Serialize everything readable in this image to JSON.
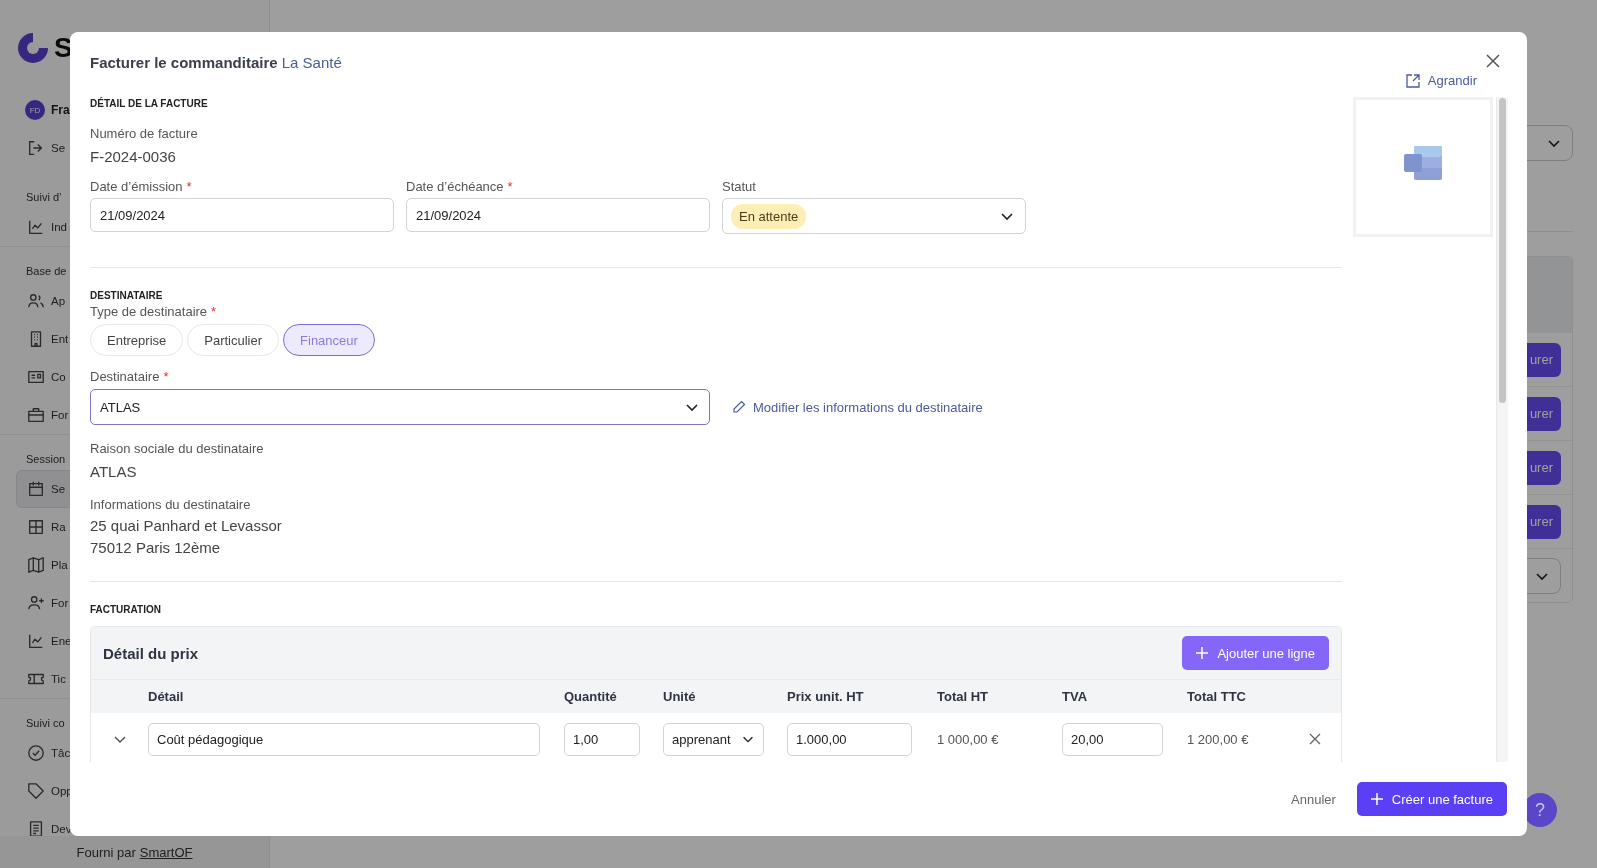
{
  "background": {
    "sidebar": {
      "logo_text": "S",
      "user": {
        "initials": "FD",
        "name": "Fra"
      },
      "top_items": [
        {
          "label": "Se",
          "selected": false
        }
      ],
      "groups": [
        {
          "heading": "Suivi d’",
          "items": [
            {
              "label": "Ind",
              "selected": false
            }
          ]
        },
        {
          "heading": "Base de",
          "items": [
            {
              "label": "Ap",
              "selected": false
            },
            {
              "label": "Ent",
              "selected": false
            },
            {
              "label": "Co",
              "selected": false
            },
            {
              "label": "For",
              "selected": false
            }
          ]
        },
        {
          "heading": "Session",
          "items": [
            {
              "label": "Se",
              "selected": true
            },
            {
              "label": "Ra",
              "selected": false
            },
            {
              "label": "Pla",
              "selected": false
            },
            {
              "label": "For",
              "selected": false
            },
            {
              "label": "Ene",
              "selected": false
            },
            {
              "label": "Tic",
              "selected": false
            }
          ]
        },
        {
          "heading": "Suivi co",
          "items": [
            {
              "label": "Tâc",
              "selected": false
            },
            {
              "label": "Opp",
              "selected": false
            },
            {
              "label": "Dev",
              "selected": false
            }
          ]
        }
      ],
      "footer": {
        "text": "Fourni par",
        "link": "SmartOF"
      }
    },
    "row_buttons": [
      "urer",
      "urer",
      "urer",
      "urer"
    ],
    "help": "?"
  },
  "modal": {
    "title": "Facturer le commanditaire",
    "subtitle": "La Santé",
    "expand": "Agrandir",
    "sections": {
      "invoice": {
        "heading": "DÉTAIL DE LA FACTURE",
        "number_label": "Numéro de facture",
        "number": "F-2024-0036",
        "fields": [
          {
            "kind": "date",
            "label": "Date d’émission",
            "mark": "*",
            "value": "21/09/2024"
          },
          {
            "kind": "date",
            "label": "Date d’échéance",
            "mark": "*",
            "value": "21/09/2024"
          },
          {
            "kind": "status",
            "label": "Statut",
            "value": "En attente"
          }
        ]
      },
      "recipient": {
        "heading": "DESTINATAIRE",
        "type_label": "Type de destinataire",
        "type_mark": "*",
        "types": [
          {
            "label": "Entreprise",
            "selected": false
          },
          {
            "label": "Particulier",
            "selected": false
          },
          {
            "label": "Financeur",
            "selected": true
          }
        ],
        "select_label": "Destinataire",
        "select_mark": "*",
        "select_value": "ATLAS",
        "edit_link": "Modifier les informations du destinataire",
        "company_label": "Raison sociale du destinataire",
        "company": "ATLAS",
        "info_label": "Informations du destinataire",
        "address": [
          "25 quai Panhard et Levassor",
          "75012 Paris 12ème"
        ]
      },
      "billing": {
        "heading": "FACTURATION",
        "card_title": "Détail du prix",
        "add_button": "Ajouter une ligne",
        "columns": [
          "Détail",
          "Quantité",
          "Unité",
          "Prix unit. HT",
          "Total HT",
          "TVA",
          "Total TTC"
        ],
        "rows": [
          {
            "detail": "Coût pédagogique",
            "quantity": "1,00",
            "unit": "apprenant",
            "unit_price": "1.000,00",
            "total_ht": "1 000,00 €",
            "vat": "20,00",
            "total_ttc": "1 200,00 €"
          }
        ]
      }
    },
    "footer": {
      "cancel": "Annuler",
      "submit": "Créer une facture"
    }
  }
}
